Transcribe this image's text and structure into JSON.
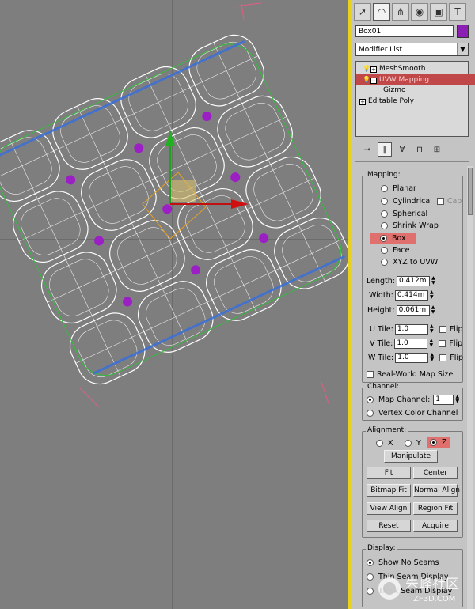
{
  "panel": {
    "tabs": [
      "create-icon",
      "modify-icon",
      "hierarchy-icon",
      "motion-icon",
      "display-icon",
      "utilities-icon"
    ],
    "object_name": "Box01",
    "object_color": "#8b1fb4",
    "modifier_list_label": "Modifier List",
    "stack": [
      {
        "label": "MeshSmooth",
        "selected": false
      },
      {
        "label": "UVW Mapping",
        "selected": true
      },
      {
        "label": "Gizmo",
        "selected": false
      },
      {
        "label": "Editable Poly",
        "selected": false
      }
    ]
  },
  "mapping": {
    "title": "Mapping:",
    "options": [
      {
        "label": "Planar",
        "selected": false
      },
      {
        "label": "Cylindrical",
        "selected": false
      },
      {
        "label": "Spherical",
        "selected": false
      },
      {
        "label": "Shrink Wrap",
        "selected": false
      },
      {
        "label": "Box",
        "selected": true
      },
      {
        "label": "Face",
        "selected": false
      },
      {
        "label": "XYZ to UVW",
        "selected": false
      }
    ],
    "cap_label": "Cap",
    "length_label": "Length:",
    "length_value": "0.412m",
    "width_label": "Width:",
    "width_value": "0.414m",
    "height_label": "Height:",
    "height_value": "0.061m",
    "utile_label": "U Tile:",
    "utile_value": "1.0",
    "vtile_label": "V Tile:",
    "vtile_value": "1.0",
    "wtile_label": "W Tile:",
    "wtile_value": "1.0",
    "flip_label": "Flip",
    "realworld_label": "Real-World Map Size"
  },
  "channel": {
    "title": "Channel:",
    "map_channel_label": "Map Channel:",
    "map_channel_value": "1",
    "vertex_color_label": "Vertex Color Channel"
  },
  "alignment": {
    "title": "Alignment:",
    "x_label": "X",
    "y_label": "Y",
    "z_label": "Z",
    "manipulate": "Manipulate",
    "fit": "Fit",
    "center": "Center",
    "bitmap_fit": "Bitmap Fit",
    "normal_align": "Normal Align",
    "view_align": "View Align",
    "region_fit": "Region Fit",
    "reset": "Reset",
    "acquire": "Acquire"
  },
  "display": {
    "title": "Display:",
    "show_no_seams": "Show No Seams",
    "thin_seam": "Thin Seam Display",
    "thick_seam": "Thick Seam Display"
  },
  "watermark": {
    "brand_cn": "朱峰社区",
    "domain": "ZF3D.COM"
  },
  "colors": {
    "viewport_bg": "#7e7e7e",
    "wire": "#ffffff",
    "gizmo": "#e8a020",
    "seam_blue": "#3a6fd8",
    "selection_red": "#c04848",
    "vertex_purple": "#9b1fc4"
  }
}
